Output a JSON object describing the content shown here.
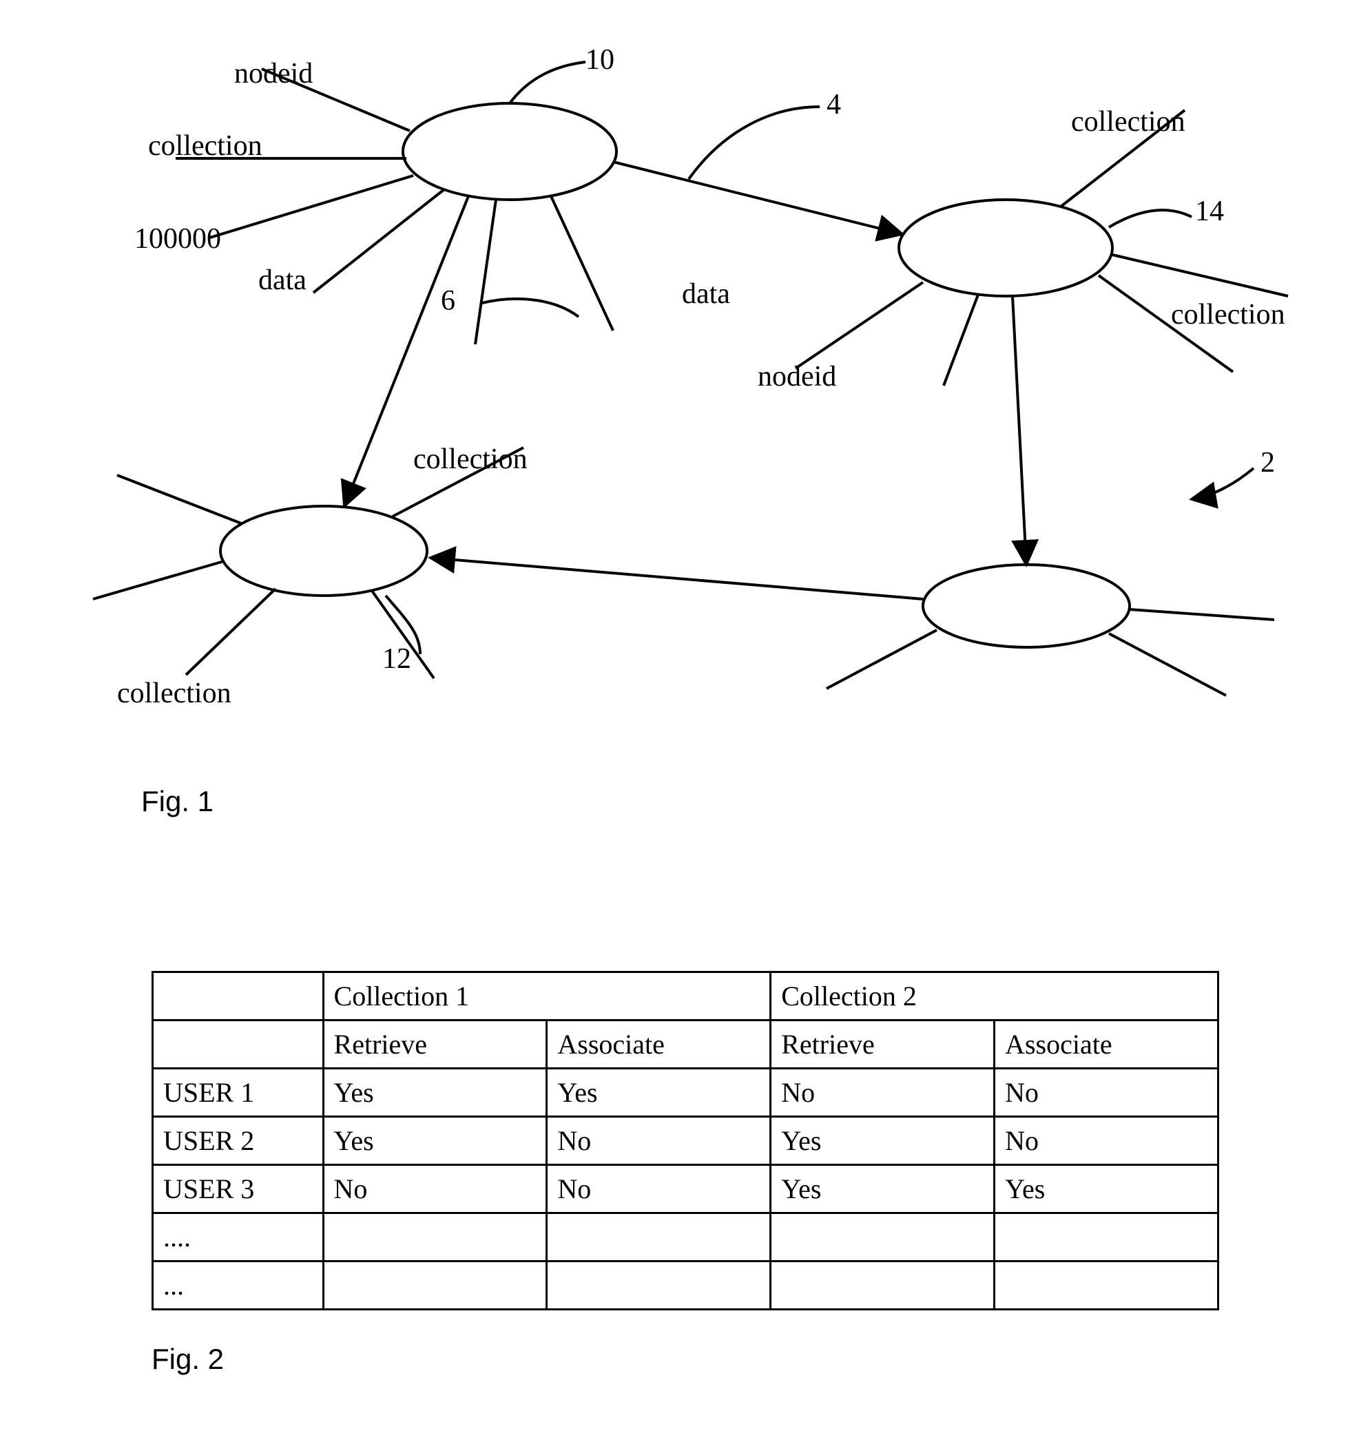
{
  "figure1": {
    "caption": "Fig. 1",
    "nodeA": {
      "ref": "10",
      "edges": {
        "nodeid": "nodeid",
        "collection": "collection",
        "ordval": "100000",
        "data": "data",
        "leadRef": "6",
        "to_nodeB_label": "data",
        "edgeRef": "4"
      }
    },
    "nodeB": {
      "ref": "14",
      "edges": {
        "collection_top": "collection",
        "collection_right": "collection",
        "nodeid": "nodeid"
      }
    },
    "nodeC": {
      "ref": "12",
      "edges": {
        "collection_top": "collection",
        "collection_bottom": "collection"
      }
    },
    "graphRef": "2"
  },
  "figure2": {
    "caption": "Fig. 2",
    "columns": {
      "col1": "Collection 1",
      "col2": "Collection 2",
      "retrieve": "Retrieve",
      "associate": "Associate"
    },
    "rows": [
      {
        "user": "USER 1",
        "c1r": "Yes",
        "c1a": "Yes",
        "c2r": "No",
        "c2a": "No"
      },
      {
        "user": "USER 2",
        "c1r": "Yes",
        "c1a": "No",
        "c2r": "Yes",
        "c2a": "No"
      },
      {
        "user": "USER 3",
        "c1r": "No",
        "c1a": "No",
        "c2r": "Yes",
        "c2a": "Yes"
      },
      {
        "user": "....",
        "c1r": "",
        "c1a": "",
        "c2r": "",
        "c2a": ""
      },
      {
        "user": "...",
        "c1r": "",
        "c1a": "",
        "c2r": "",
        "c2a": ""
      }
    ]
  }
}
